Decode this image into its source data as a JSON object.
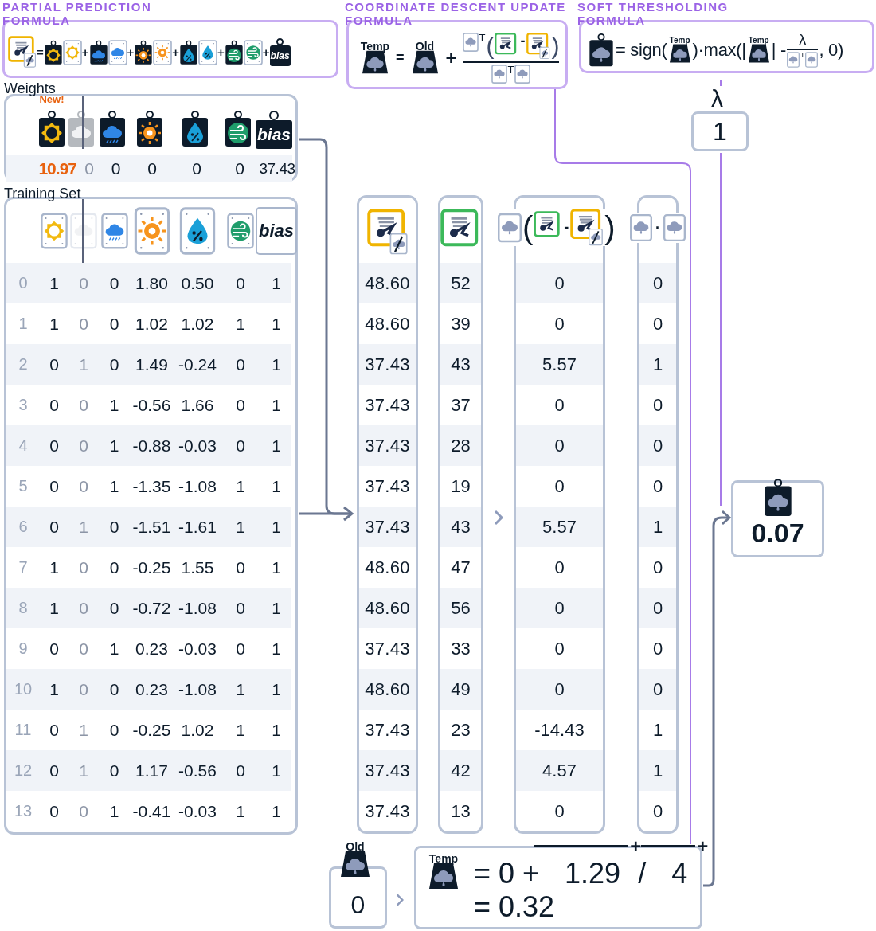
{
  "partial_formula": {
    "title": "PARTIAL PREDICTION FORMULA",
    "equals": "=",
    "terms": [
      {
        "kind": "sun"
      },
      {
        "kind": "rain",
        "plus": "+"
      },
      {
        "kind": "temp",
        "plus": "+"
      },
      {
        "kind": "humidity",
        "plus": "+"
      },
      {
        "kind": "wind",
        "plus": "+"
      },
      {
        "kind": "bias",
        "plus": "+",
        "label": "bias"
      }
    ]
  },
  "update_formula": {
    "title": "COORDINATE DESCENT UPDATE FORMULA",
    "lhs_label": "Temp",
    "equals": "=",
    "old_label": "Old",
    "plus": "+",
    "transpose": "T",
    "open": "(",
    "minus": "-",
    "close": ")",
    "denominator_transpose": "T"
  },
  "soft_formula": {
    "title": "SOFT THRESHOLDING FORMULA",
    "sign": "= sign(",
    "temp_label": "Temp",
    "max": ")·max(|",
    "temp_label_2": "Temp",
    "minus": "| -",
    "numerator": "λ",
    "transpose": "T",
    "tail": ", 0)"
  },
  "weights": {
    "title": "Weights",
    "badge": "New!",
    "tags": [
      {
        "kind": "sun",
        "selected": true,
        "disabled": false,
        "value": "10.97"
      },
      {
        "kind": "cloud",
        "selected": false,
        "disabled": true,
        "value": "0"
      },
      {
        "kind": "rain",
        "selected": false,
        "disabled": false,
        "value": "0"
      },
      {
        "kind": "temp",
        "selected": false,
        "disabled": false,
        "value": "0"
      },
      {
        "kind": "humidity",
        "selected": false,
        "disabled": false,
        "value": "0"
      },
      {
        "kind": "wind",
        "selected": false,
        "disabled": false,
        "value": "0"
      },
      {
        "kind": "bias",
        "label": "bias",
        "selected": false,
        "disabled": false,
        "value": "37.43"
      }
    ]
  },
  "training_set": {
    "title": "Training Set",
    "columns": [
      {
        "kind": "sun",
        "disabled": false
      },
      {
        "kind": "cloud",
        "disabled": true
      },
      {
        "kind": "rain",
        "disabled": false
      },
      {
        "kind": "temp",
        "disabled": false
      },
      {
        "kind": "humidity",
        "disabled": false
      },
      {
        "kind": "wind",
        "disabled": false
      },
      {
        "kind": "bias",
        "label": "bias",
        "disabled": false
      }
    ],
    "rows": [
      {
        "index": "0",
        "values": [
          "1",
          "0",
          "0",
          "1.80",
          "0.50",
          "0",
          "1"
        ]
      },
      {
        "index": "1",
        "values": [
          "1",
          "0",
          "0",
          "1.02",
          "1.02",
          "1",
          "1"
        ]
      },
      {
        "index": "2",
        "values": [
          "0",
          "1",
          "0",
          "1.49",
          "-0.24",
          "0",
          "1"
        ]
      },
      {
        "index": "3",
        "values": [
          "0",
          "0",
          "1",
          "-0.56",
          "1.66",
          "0",
          "1"
        ]
      },
      {
        "index": "4",
        "values": [
          "0",
          "0",
          "1",
          "-0.88",
          "-0.03",
          "0",
          "1"
        ]
      },
      {
        "index": "5",
        "values": [
          "0",
          "0",
          "1",
          "-1.35",
          "-1.08",
          "1",
          "1"
        ]
      },
      {
        "index": "6",
        "values": [
          "0",
          "1",
          "0",
          "-1.51",
          "-1.61",
          "1",
          "1"
        ]
      },
      {
        "index": "7",
        "values": [
          "1",
          "0",
          "0",
          "-0.25",
          "1.55",
          "0",
          "1"
        ]
      },
      {
        "index": "8",
        "values": [
          "1",
          "0",
          "0",
          "-0.72",
          "-1.08",
          "0",
          "1"
        ]
      },
      {
        "index": "9",
        "values": [
          "0",
          "0",
          "1",
          "0.23",
          "-0.03",
          "0",
          "1"
        ]
      },
      {
        "index": "10",
        "values": [
          "1",
          "0",
          "0",
          "0.23",
          "-1.08",
          "1",
          "1"
        ]
      },
      {
        "index": "11",
        "values": [
          "0",
          "1",
          "0",
          "-0.25",
          "1.02",
          "1",
          "1"
        ]
      },
      {
        "index": "12",
        "values": [
          "0",
          "1",
          "0",
          "1.17",
          "-0.56",
          "0",
          "1"
        ]
      },
      {
        "index": "13",
        "values": [
          "0",
          "0",
          "1",
          "-0.41",
          "-0.03",
          "1",
          "1"
        ]
      }
    ]
  },
  "calc_columns": [
    {
      "kind": "prediction",
      "values": [
        "48.60",
        "48.60",
        "37.43",
        "37.43",
        "37.43",
        "37.43",
        "37.43",
        "48.60",
        "48.60",
        "37.43",
        "48.60",
        "37.43",
        "37.43",
        "37.43"
      ]
    },
    {
      "kind": "actual",
      "values": [
        "52",
        "39",
        "43",
        "37",
        "28",
        "19",
        "43",
        "47",
        "56",
        "33",
        "49",
        "23",
        "42",
        "13"
      ]
    },
    {
      "kind": "residual",
      "open": "(",
      "minus": "-",
      "close": ")",
      "values": [
        "0",
        "0",
        "5.57",
        "0",
        "0",
        "0",
        "5.57",
        "0",
        "0",
        "0",
        "0",
        "-14.43",
        "4.57",
        "0"
      ]
    },
    {
      "kind": "square",
      "dot": "·",
      "values": [
        "0",
        "0",
        "1",
        "0",
        "0",
        "0",
        "1",
        "0",
        "0",
        "0",
        "0",
        "1",
        "1",
        "0"
      ]
    }
  ],
  "lambda": {
    "symbol": "λ",
    "value": "1"
  },
  "result": {
    "value": "0.07"
  },
  "old": {
    "label": "Old",
    "value": "0"
  },
  "temp": {
    "label": "Temp",
    "parts": [
      {
        "text": "= 0 +"
      },
      {
        "text": "1.29",
        "sum": "+"
      },
      {
        "text": "/"
      },
      {
        "text": "4",
        "sum": "+"
      }
    ],
    "line2": "= 0.32"
  }
}
